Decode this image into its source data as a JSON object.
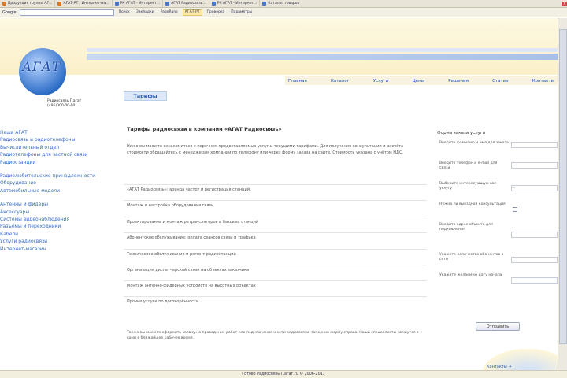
{
  "browser": {
    "tabs": [
      "Продукция группы АГ...",
      "АГАТ-РТ / Интернет-ма...",
      "РК АГАТ - Интернет...",
      "АГАТ Радиосвязь...",
      "РК АГАТ - Интернет...",
      "Каталог товаров"
    ],
    "toolbar": {
      "search_label": "Google",
      "search_value": "",
      "buttons": [
        "Поиск",
        "Закладки",
        "PageRank",
        "АГАТ-РТ",
        "Проверка",
        "Параметры"
      ]
    },
    "status_text": "Готово   Радиосвязь Г.агат.ru   © 2006-2011"
  },
  "header": {
    "logo_text": "АГАТ",
    "phone_lines": [
      "Радиосвязь Г.агат",
      "(495)000-00-00"
    ]
  },
  "topnav": [
    "Главная",
    "Каталог",
    "Услуги",
    "Цены",
    "Решения",
    "Статьи",
    "Контакты"
  ],
  "main": {
    "badge": "Тарифы",
    "title": "Тарифы радиосвязи в компании «АГАТ Радиосвязь»",
    "intro": "Ниже вы можете ознакомиться с перечнем предоставляемых услуг и текущими тарифами. Для получения консультации и расчёта стоимости обращайтесь к менеджерам компании по телефону или через форму заказа на сайте. Стоимость указана с учётом НДС.",
    "services": [
      "«АГАТ Радиосвязь»: аренда частот и регистрация станций",
      "Монтаж и настройка оборудования связи",
      "Проектирование и монтаж ретрансляторов и базовых станций",
      "Абонентское обслуживание: оплата сеансов связи и трафика",
      "Техническое обслуживание и ремонт радиостанций",
      "Организация диспетчерской связи на объектах заказчика",
      "Монтаж антенно-фидерных устройств на высотных объектах",
      "Прочие услуги по договорённости"
    ],
    "footer_note": "Также вы можете оформить заявку на проведение работ или подключение к сети радиосвязи, заполнив форму справа. Наши специалисты свяжутся с вами в ближайшее рабочее время."
  },
  "sidebar": {
    "group1": [
      "Наша АГАТ",
      "Радиосвязь и радиотелефоны",
      "Вычислительный отдел",
      "Радиотелефоны для частной связи",
      "Радиостанции"
    ],
    "group2": [
      "Радиолюбительские принадлежности",
      "Оборудование",
      "Автомобильные модели"
    ],
    "group3": [
      "Антенны и фидеры",
      "Аксессуары",
      "Системы видеонаблюдения",
      "Разъёмы и переходники",
      "Кабели",
      "Услуги радиосвязи",
      "Интернет-магазин"
    ]
  },
  "form": {
    "title": "Форма заказа услуги",
    "fields": [
      {
        "label": "Введите фамилию и имя для заказа",
        "kind": "input"
      },
      {
        "label": "Введите телефон и e-mail для связи",
        "kind": "input"
      },
      {
        "label": "Выберите интересующую вас услугу",
        "kind": "select",
        "value": "..."
      },
      {
        "label": "Нужна ли выездная консультация",
        "kind": "check"
      },
      {
        "label": "Введите адрес объекта для подключения",
        "kind": "input"
      },
      {
        "label": "Укажите количество абонентов в сети",
        "kind": "input"
      },
      {
        "label": "Укажите желаемую дату начала",
        "kind": "input"
      }
    ],
    "submit_label": "Отправить"
  },
  "bottom_link": "Контакты →"
}
